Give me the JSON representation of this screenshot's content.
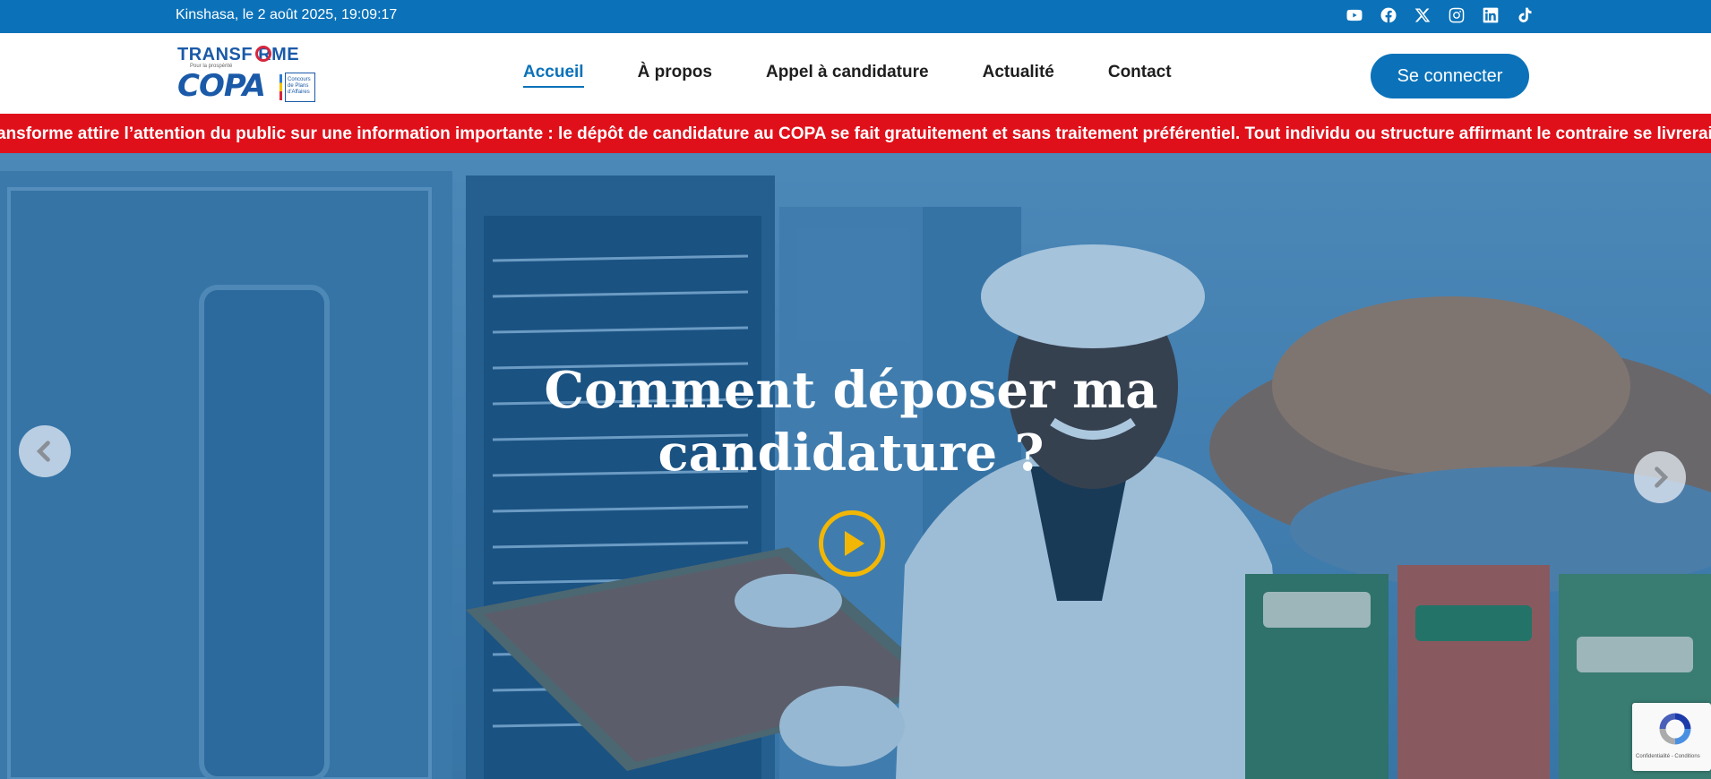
{
  "topbar": {
    "datetime": "Kinshasa, le 2 août 2025, 19:09:17",
    "socials": [
      "youtube-icon",
      "facebook-icon",
      "x-icon",
      "instagram-icon",
      "linkedin-icon",
      "tiktok-icon"
    ]
  },
  "logo": {
    "line1": "TRANSF RME",
    "tagline": "Pour la prospérité",
    "line2": "COPA",
    "box": "Concours de Plans d'Affaires"
  },
  "nav": {
    "items": [
      "Accueil",
      "À propos",
      "Appel à candidature",
      "Actualité",
      "Contact"
    ],
    "active": "Accueil"
  },
  "header": {
    "login_label": "Se connecter"
  },
  "ticker": {
    "text": "ansforme attire l’attention du public sur une information importante : le dépôt de candidature au COPA se fait gratuitement et sans traitement préférentiel. Tout individu ou structure affirmant le contraire se livrerait à"
  },
  "hero": {
    "title_line1": "Comment déposer ma",
    "title_line2": "candidature ?"
  },
  "recaptcha": {
    "footer": "Confidentialité - Conditions"
  },
  "colors": {
    "brand_blue": "#0b72b9",
    "ticker_red": "#e0101a",
    "play_yellow": "#f2b705"
  }
}
